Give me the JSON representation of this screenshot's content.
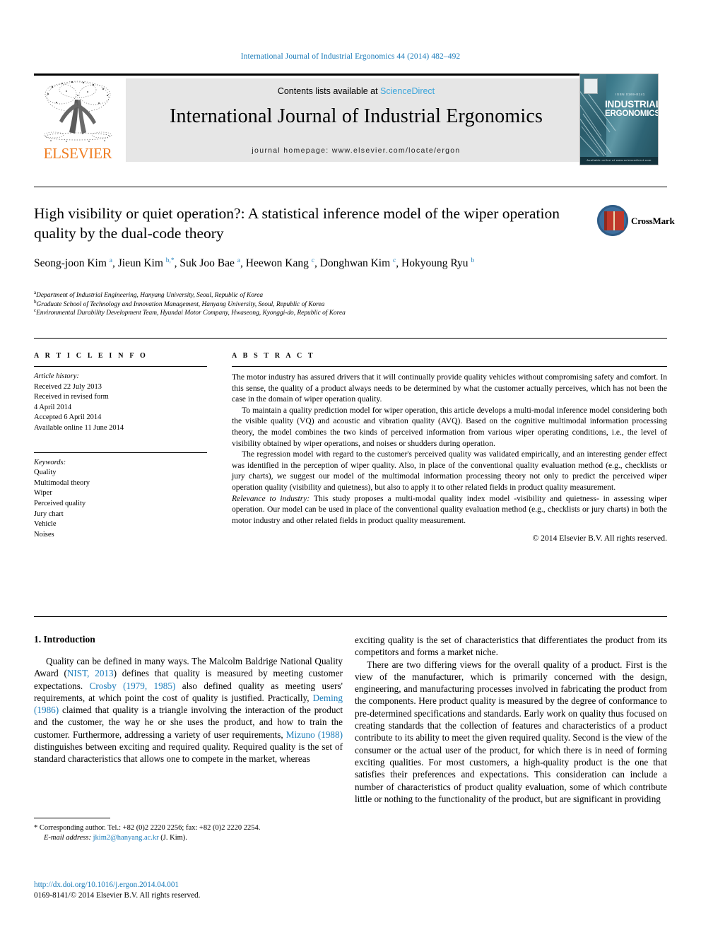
{
  "running_head": "International Journal of Industrial Ergonomics 44 (2014) 482–492",
  "masthead": {
    "contents_prefix": "Contents lists available at ",
    "sciencedirect": "ScienceDirect",
    "journal_title": "International Journal of Industrial Ergonomics",
    "homepage": "journal homepage: www.elsevier.com/locate/ergon",
    "publisher_logo_text": "ELSEVIER",
    "cover": {
      "issn": "ISSN 0169-8141",
      "line1": "INDUSTRIAL",
      "line2": "ERGONOMICS",
      "footer": "Available online at www.sciencedirect.com"
    }
  },
  "article": {
    "title": "High visibility or quiet operation?: A statistical inference model of the wiper operation quality by the dual-code theory",
    "crossmark_label": "CrossMark",
    "authors_html": "Seong-joon Kim <sup>a</sup>, Jieun Kim <sup>b,</sup><sup>*</sup>, Suk Joo Bae <sup>a</sup>, Heewon Kang <sup>c</sup>, Donghwan Kim <sup>c</sup>, Hokyoung Ryu <sup>b</sup>",
    "affiliations": [
      {
        "mark": "a",
        "text": "Department of Industrial Engineering, Hanyang University, Seoul, Republic of Korea"
      },
      {
        "mark": "b",
        "text": "Graduate School of Technology and Innovation Management, Hanyang University, Seoul, Republic of Korea"
      },
      {
        "mark": "c",
        "text": "Environmental Durability Development Team, Hyundai Motor Company, Hwaseong, Kyonggi-do, Republic of Korea"
      }
    ]
  },
  "article_info": {
    "heading": "A R T I C L E  I N F O",
    "history_label": "Article history:",
    "history": [
      "Received 22 July 2013",
      "Received in revised form",
      "4 April 2014",
      "Accepted 6 April 2014",
      "Available online 11 June 2014"
    ],
    "keywords_label": "Keywords:",
    "keywords": [
      "Quality",
      "Multimodal theory",
      "Wiper",
      "Perceived quality",
      "Jury chart",
      "Vehicle",
      "Noises"
    ]
  },
  "abstract": {
    "heading": "A B S T R A C T",
    "paragraphs": [
      "The motor industry has assured drivers that it will continually provide quality vehicles without compromising safety and comfort. In this sense, the quality of a product always needs to be determined by what the customer actually perceives, which has not been the case in the domain of wiper operation quality.",
      "To maintain a quality prediction model for wiper operation, this article develops a multi-modal inference model considering both the visible quality (VQ) and acoustic and vibration quality (AVQ). Based on the cognitive multimodal information processing theory, the model combines the two kinds of perceived information from various wiper operating conditions, i.e., the level of visibility obtained by wiper operations, and noises or shudders during operation.",
      "The regression model with regard to the customer's perceived quality was validated empirically, and an interesting gender effect was identified in the perception of wiper quality. Also, in place of the conventional quality evaluation method (e.g., checklists or jury charts), we suggest our model of the multimodal information processing theory not only to predict the perceived wiper operation quality (visibility and quietness), but also to apply it to other related fields in product quality measurement."
    ],
    "relevance_label": "Relevance to industry:",
    "relevance_text": " This study proposes a multi-modal quality index model -visibility and quietness- in assessing wiper operation. Our model can be used in place of the conventional quality evaluation method (e.g., checklists or jury charts) in both the motor industry and other related fields in product quality measurement.",
    "copyright": "© 2014 Elsevier B.V. All rights reserved."
  },
  "introduction": {
    "section_title": "1. Introduction",
    "left_paragraph_html": "Quality can be defined in many ways. The Malcolm Baldrige National Quality Award (<span class=\"cite\">NIST, 2013</span>) defines that quality is measured by meeting customer expectations. <span class=\"cite\">Crosby (1979, 1985)</span> also defined quality as meeting users' requirements, at which point the cost of quality is justified. Practically, <span class=\"cite\">Deming (1986)</span> claimed that quality is a triangle involving the interaction of the product and the customer, the way he or she uses the product, and how to train the customer. Furthermore, addressing a variety of user requirements, <span class=\"cite\">Mizuno (1988)</span> distinguishes between exciting and required quality. Required quality is the set of standard characteristics that allows one to compete in the market, whereas",
    "right_paragraph_1": "exciting quality is the set of characteristics that differentiates the product from its competitors and forms a market niche.",
    "right_paragraph_2": "There are two differing views for the overall quality of a product. First is the view of the manufacturer, which is primarily concerned with the design, engineering, and manufacturing processes involved in fabricating the product from the components. Here product quality is measured by the degree of conformance to pre-determined specifications and standards. Early work on quality thus focused on creating standards that the collection of features and characteristics of a product contribute to its ability to meet the given required quality. Second is the view of the consumer or the actual user of the product, for which there is in need of forming exciting qualities. For most customers, a high-quality product is the one that satisfies their preferences and expectations. This consideration can include a number of characteristics of product quality evaluation, some of which contribute little or nothing to the functionality of the product, but are significant in providing"
  },
  "footnote": {
    "corresponding": "* Corresponding author. Tel.: +82 (0)2 2220 2256; fax: +82 (0)2 2220 2254.",
    "email_label": "E-mail address:",
    "email": "jkim2@hanyang.ac.kr",
    "email_suffix": "(J. Kim).",
    "doi": "http://dx.doi.org/10.1016/j.ergon.2014.04.001",
    "issn_line": "0169-8141/© 2014 Elsevier B.V. All rights reserved."
  },
  "colors": {
    "link_blue": "#1a7bb9",
    "sciencedirect_blue": "#3aa5dc",
    "elsevier_orange": "#ef7d22",
    "panel_gray": "#e6e6e6"
  }
}
